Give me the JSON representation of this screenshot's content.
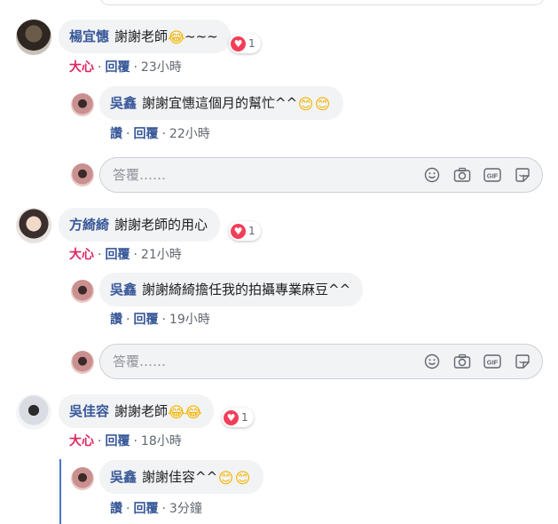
{
  "comments": [
    {
      "author": "楊宜憓",
      "text": "謝謝老師",
      "emoji": "😂",
      "suffix": "~~~",
      "reaction_count": "1",
      "meta": {
        "action": "大心",
        "reply": "回覆",
        "time": "23小時"
      },
      "reply": {
        "author": "吳鑫",
        "text": "謝謝宜憓這個月的幫忙^^",
        "emoji": "😊",
        "meta": {
          "action": "讚",
          "reply": "回覆",
          "time": "22小時"
        }
      }
    },
    {
      "author": "方綺綺",
      "text": "謝謝老師的用心",
      "reaction_count": "1",
      "meta": {
        "action": "大心",
        "reply": "回覆",
        "time": "21小時"
      },
      "reply": {
        "author": "吳鑫",
        "text": "謝謝綺綺擔任我的拍攝專業麻豆^^",
        "meta": {
          "action": "讚",
          "reply": "回覆",
          "time": "19小時"
        }
      }
    },
    {
      "author": "吳佳容",
      "text": "謝謝老師",
      "emoji": "😂",
      "reaction_count": "1",
      "meta": {
        "action": "大心",
        "reply": "回覆",
        "time": "18小時"
      },
      "reply": {
        "author": "吳鑫",
        "text": "謝謝佳容^^",
        "emoji": "😊",
        "meta": {
          "action": "讚",
          "reply": "回覆",
          "time": "3分鐘"
        }
      }
    }
  ],
  "reply_box": {
    "placeholder": "答覆……"
  },
  "icons": [
    "emoji-icon",
    "camera-icon",
    "gif-icon",
    "sticker-icon"
  ],
  "colors": {
    "name": "#385898",
    "love": "#e0245e",
    "heart": "#f33e58",
    "bubble": "#f2f3f5"
  }
}
